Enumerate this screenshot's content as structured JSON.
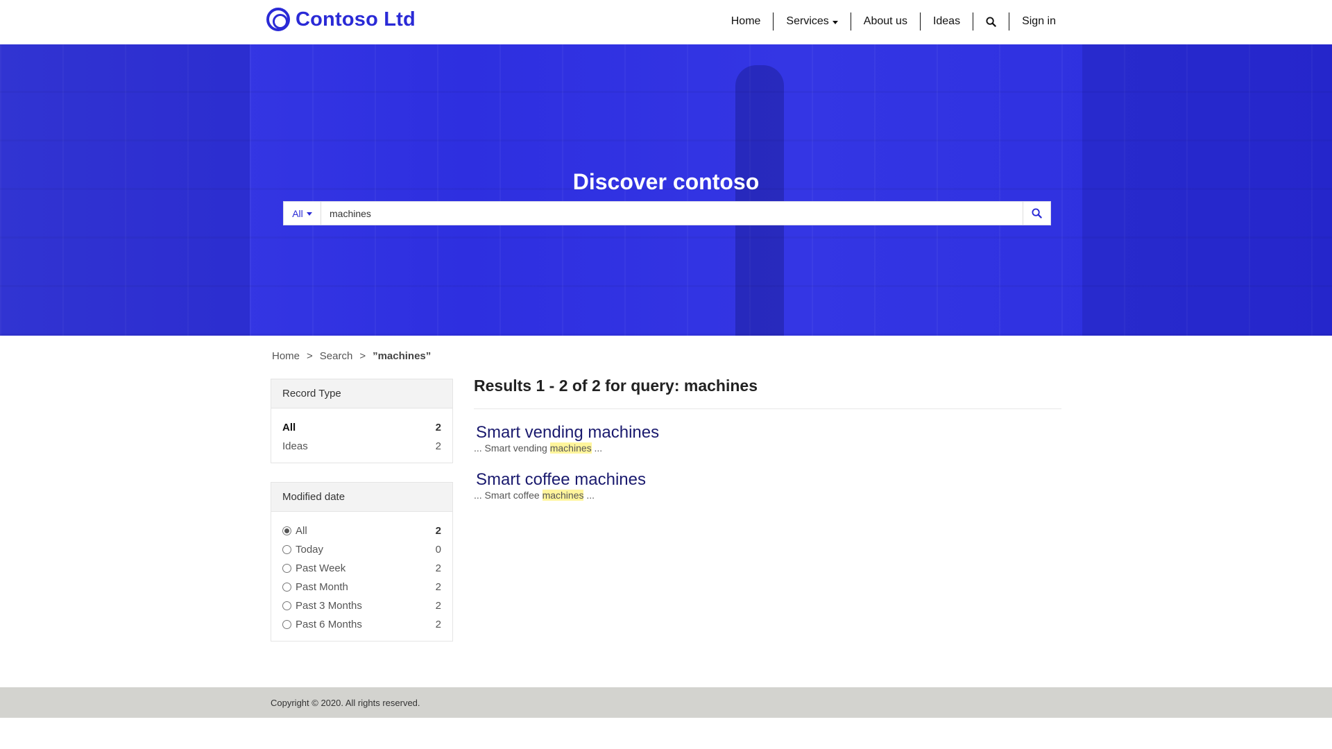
{
  "brand": {
    "name": "Contoso Ltd"
  },
  "nav": {
    "home": "Home",
    "services": "Services",
    "about": "About us",
    "ideas": "Ideas",
    "search_icon": "search-icon",
    "sign_in": "Sign in"
  },
  "hero": {
    "title": "Discover contoso",
    "search": {
      "scope": "All",
      "query": "machines",
      "button_icon": "search-icon"
    }
  },
  "breadcrumb": {
    "home": "Home",
    "sep": ">",
    "search": "Search",
    "current": "”machines”"
  },
  "facets": {
    "record_type": {
      "title": "Record Type",
      "items": [
        {
          "label": "All",
          "count": "2",
          "active": true
        },
        {
          "label": "Ideas",
          "count": "2",
          "active": false
        }
      ]
    },
    "modified_date": {
      "title": "Modified date",
      "items": [
        {
          "label": "All",
          "count": "2",
          "checked": true
        },
        {
          "label": "Today",
          "count": "0",
          "checked": false
        },
        {
          "label": "Past Week",
          "count": "2",
          "checked": false
        },
        {
          "label": "Past Month",
          "count": "2",
          "checked": false
        },
        {
          "label": "Past 3 Months",
          "count": "2",
          "checked": false
        },
        {
          "label": "Past 6 Months",
          "count": "2",
          "checked": false
        }
      ]
    }
  },
  "results": {
    "summary": "Results 1 - 2 of 2 for query: machines",
    "items": [
      {
        "title": "Smart vending machines",
        "snippet_pre": "... Smart vending ",
        "snippet_hl": "machines",
        "snippet_post": " ..."
      },
      {
        "title": "Smart coffee machines",
        "snippet_pre": "... Smart coffee ",
        "snippet_hl": "machines",
        "snippet_post": " ..."
      }
    ]
  },
  "footer": {
    "copyright": "Copyright © 2020. All rights reserved."
  },
  "colors": {
    "brand": "#2a2ad6",
    "hero": "#3133e2",
    "result_title": "#1a1a6e",
    "highlight": "#fff59c",
    "footer": "#d3d3cf"
  }
}
